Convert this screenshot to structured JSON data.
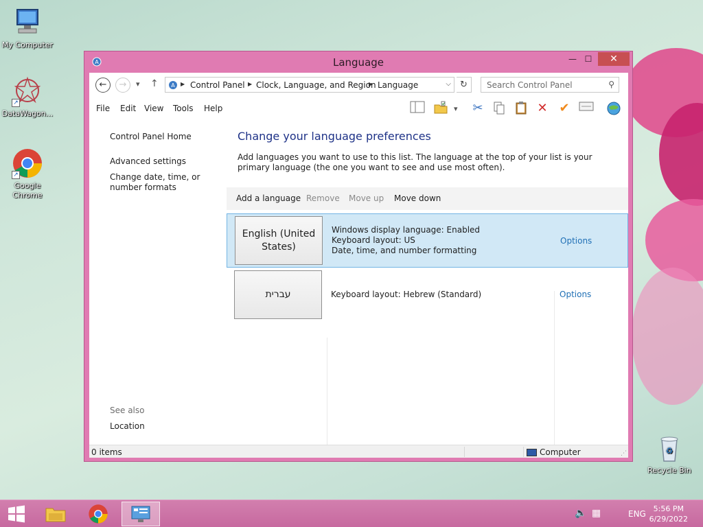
{
  "desktop": {
    "icons": [
      {
        "label": "My Computer"
      },
      {
        "label": "DataWagon..."
      },
      {
        "label": "Google Chrome"
      },
      {
        "label": "Recycle Bin"
      }
    ]
  },
  "window": {
    "title": "Language",
    "controls": {
      "minimize": "—",
      "maximize": "☐",
      "close": "✕"
    }
  },
  "address_bar": {
    "breadcrumbs": [
      "Control Panel",
      "Clock, Language, and Region",
      "Language"
    ],
    "search_placeholder": "Search Control Panel"
  },
  "menu": {
    "items": [
      "File",
      "Edit",
      "View",
      "Tools",
      "Help"
    ]
  },
  "left_pane": {
    "home_link": "Control Panel Home",
    "links": [
      "Advanced settings",
      "Change date, time, or number formats"
    ],
    "see_also_label": "See also",
    "see_also_links": [
      "Location"
    ]
  },
  "main": {
    "title": "Change your language preferences",
    "description": "Add languages you want to use to this list. The language at the top of your list is your primary language (the one you want to see and use most often).",
    "toolbar": {
      "add": "Add a language",
      "remove": "Remove",
      "move_up": "Move up",
      "move_down": "Move down"
    },
    "languages": [
      {
        "name": "English (United States)",
        "details": [
          "Windows display language: Enabled",
          "Keyboard layout: US",
          "Date, time, and number formatting"
        ],
        "options_label": "Options",
        "selected": true
      },
      {
        "name": "עברית",
        "details": [
          "Keyboard layout: Hebrew (Standard)"
        ],
        "options_label": "Options",
        "selected": false
      }
    ]
  },
  "status_bar": {
    "items_text": "0 items",
    "location_text": "Computer"
  },
  "taskbar": {
    "language": "ENG",
    "time": "5:56 PM",
    "date": "6/29/2022"
  },
  "colors": {
    "window_frame": "#e07bb2",
    "close_button": "#c74f52",
    "title_blue": "#1e3287",
    "link_blue": "#1f6fb5",
    "selection_bg": "#d1e8f6",
    "selection_border": "#72b4e4"
  }
}
